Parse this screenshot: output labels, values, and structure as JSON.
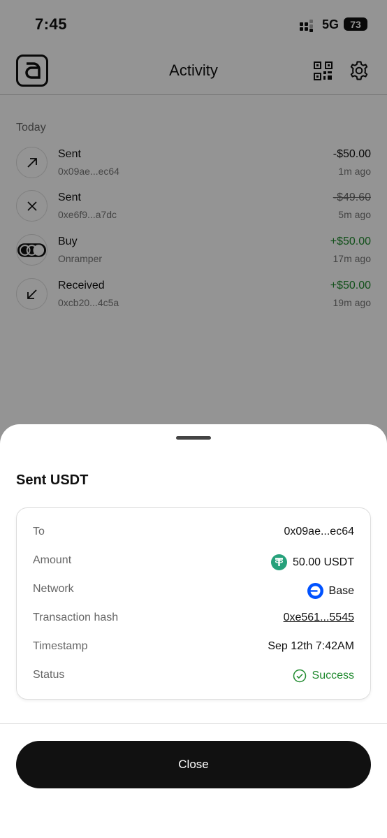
{
  "status_bar": {
    "time": "7:45",
    "network": "5G",
    "battery": "73"
  },
  "header": {
    "title": "Activity"
  },
  "activity": {
    "section_label": "Today",
    "items": [
      {
        "name": "Sent",
        "sub": "0x09ae...ec64",
        "amount": "-$50.00",
        "ago": "1m ago",
        "kind": "sent",
        "icon": "arrow-up-right-icon"
      },
      {
        "name": "Sent",
        "sub": "0xe6f9...a7dc",
        "amount": "-$49.60",
        "ago": "5m ago",
        "kind": "failed",
        "icon": "x-icon"
      },
      {
        "name": "Buy",
        "sub": "Onramper",
        "amount": "+$50.00",
        "ago": "17m ago",
        "kind": "buy",
        "icon": "onramper-icon"
      },
      {
        "name": "Received",
        "sub": "0xcb20...4c5a",
        "amount": "+$50.00",
        "ago": "19m ago",
        "kind": "received",
        "icon": "arrow-down-left-icon"
      }
    ]
  },
  "sheet": {
    "title": "Sent USDT",
    "details": {
      "to": {
        "label": "To",
        "value": "0x09ae...ec64"
      },
      "amount": {
        "label": "Amount",
        "value": "50.00 USDT"
      },
      "network": {
        "label": "Network",
        "value": "Base"
      },
      "hash": {
        "label": "Transaction hash",
        "value": "0xe561...5545"
      },
      "timestamp": {
        "label": "Timestamp",
        "value": "Sep 12th 7:42AM"
      },
      "status": {
        "label": "Status",
        "value": "Success"
      }
    },
    "close_label": "Close"
  },
  "colors": {
    "success": "#1f8a2e",
    "tether": "#26a17b",
    "base": "#0052ff"
  }
}
